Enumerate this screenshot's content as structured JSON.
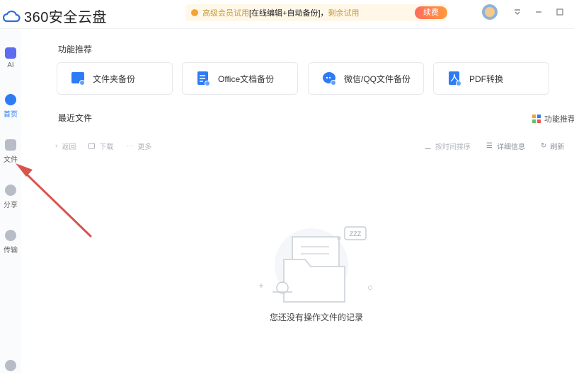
{
  "app": {
    "title": "360安全云盘"
  },
  "promo": {
    "text_a": "高级会员试用",
    "text_b": "[在线编辑+自动备份]，",
    "text_c": "剩余试用",
    "button": "续费"
  },
  "sidebar": {
    "items": [
      {
        "label": "AI"
      },
      {
        "label": "首页"
      },
      {
        "label": "文件"
      },
      {
        "label": "分享"
      },
      {
        "label": "传输"
      }
    ]
  },
  "main": {
    "features_title": "功能推荐",
    "features": [
      {
        "label": "文件夹备份"
      },
      {
        "label": "Office文档备份"
      },
      {
        "label": "微信/QQ文件备份"
      },
      {
        "label": "PDF转换"
      }
    ],
    "recent_title": "最近文件",
    "feature_recommend_link": "功能推荐",
    "toolbar_left": {
      "back": "返回",
      "download": "下载",
      "more": "更多"
    },
    "toolbar_right": {
      "sort": "按时间排序",
      "details": "详细信息",
      "refresh": "刷新"
    },
    "empty_message": "您还没有操作文件的记录",
    "zzz": "ZZZ"
  },
  "colors": {
    "accent": "#2d7cf6",
    "arrow": "#d9534f",
    "promo_bg": "#fff8e8"
  }
}
